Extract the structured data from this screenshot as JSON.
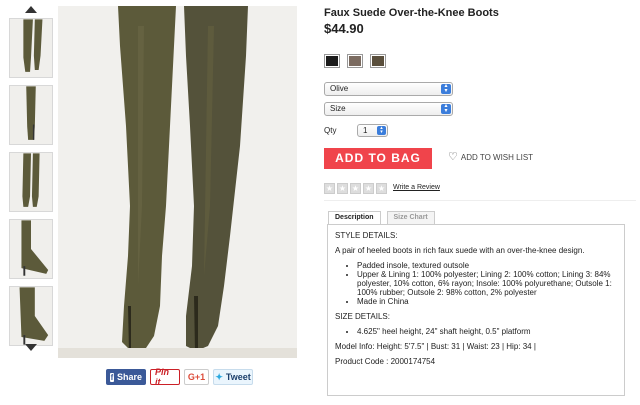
{
  "product": {
    "title": "Faux Suede Over-the-Knee Boots",
    "price": "$44.90"
  },
  "swatches": [
    {
      "name": "Black",
      "color": "#1c1c1c"
    },
    {
      "name": "Taupe",
      "color": "#7b6b60"
    },
    {
      "name": "Olive",
      "color": "#5a4f3c"
    }
  ],
  "selects": {
    "color_value": "Olive",
    "size_value": "Size",
    "qty_label": "Qty",
    "qty_value": "1"
  },
  "actions": {
    "add_to_bag": "ADD TO BAG",
    "wishlist": "ADD TO WISH LIST",
    "write_review": "Write a Review"
  },
  "tabs": [
    {
      "label": "Description",
      "active": true
    },
    {
      "label": "Size Chart",
      "active": false
    }
  ],
  "description": {
    "style_heading": "STYLE DETAILS:",
    "intro": "A pair of heeled boots in rich faux suede with an over-the-knee design.",
    "bullets": [
      "Padded insole, textured outsole",
      "Upper & Lining 1: 100% polyester; Lining 2: 100% cotton; Lining 3: 84% polyester, 10% cotton, 6% rayon; Insole: 100% polyurethane; Outsole 1: 100% rubber; Outsole 2: 98% cotton, 2% polyester",
      "Made in China"
    ],
    "size_heading": "SIZE DETAILS:",
    "size_bullets": [
      "4.625\" heel height, 24\" shaft height, 0.5\" platform"
    ],
    "model_info": "Model Info: Height: 5'7.5\" | Bust: 31 | Waist: 23 | Hip: 34 |",
    "product_code": "Product Code : 2000174754"
  },
  "share": {
    "facebook": "Share",
    "pinterest": "Pin it",
    "gplus": "G+1",
    "twitter": "Tweet"
  },
  "colors": {
    "accent_red": "#f0444b",
    "boot_olive": "#5c5a3a",
    "select_blue": "#3b7ddb"
  }
}
